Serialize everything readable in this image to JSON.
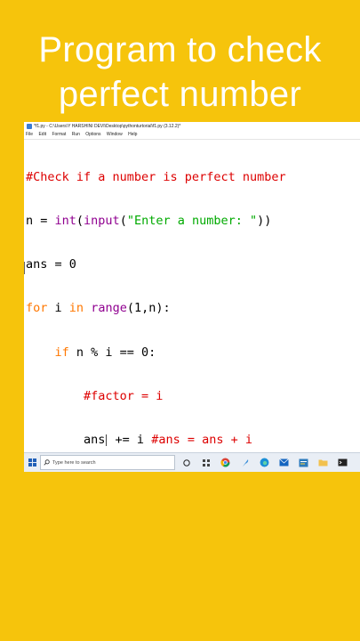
{
  "headline": {
    "line1": "Program to check",
    "line2": "perfect number"
  },
  "window": {
    "title": "*f1.py - C:\\Users\\Y HARSHINI DEVI\\Desktop\\pythonturtorial\\f1.py (3.12.2)*",
    "menu": [
      "File",
      "Edit",
      "Format",
      "Run",
      "Options",
      "Window",
      "Help"
    ]
  },
  "code": {
    "l1_comment": "#Check if a number is perfect number",
    "l2_a": "n = ",
    "l2_int": "int",
    "l2_b": "(",
    "l2_input": "input",
    "l2_c": "(",
    "l2_str": "\"Enter a number: \"",
    "l2_d": "))",
    "l3": "ans = 0",
    "l4_for": "for",
    "l4_a": " i ",
    "l4_in": "in",
    "l4_b": " ",
    "l4_range": "range",
    "l4_c": "(1,n):",
    "l5_indent": "    ",
    "l5_if": "if",
    "l5_b": " n % i == 0:",
    "l6_indent": "        ",
    "l6_comment": "#factor = i",
    "l7_indent": "        ",
    "l7_a": "ans",
    "l7_b": " += i ",
    "l7_comment": "#ans = ans + i"
  },
  "taskbar": {
    "search_placeholder": "Type here to search",
    "apps": [
      "task-view-icon",
      "widgets-icon",
      "chrome-icon",
      "feather-icon",
      "edge-icon",
      "mail-icon",
      "python-icon",
      "folder-icon",
      "terminal-icon"
    ]
  },
  "colors": {
    "background": "#f6c40c",
    "comment": "#dd0000",
    "builtin": "#900090",
    "string": "#00aa00",
    "keyword": "#ff7700"
  }
}
